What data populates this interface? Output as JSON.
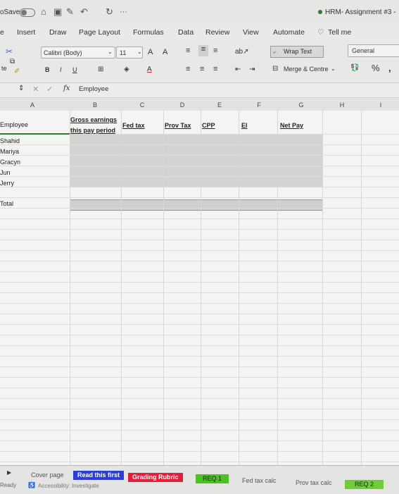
{
  "titlebar": {
    "autosave": "oSave",
    "more": "···",
    "doc_title": "HRM- Assignment #3 -",
    "icons": [
      "home-icon",
      "save-icon",
      "edit-icon",
      "undo-icon",
      "redo-icon"
    ]
  },
  "menu": {
    "items": [
      "e",
      "Insert",
      "Draw",
      "Page Layout",
      "Formulas",
      "Data",
      "Review",
      "View",
      "Automate"
    ],
    "tell_me": "Tell me"
  },
  "ribbon": {
    "paste": "te",
    "font_name": "Calibri (Body)",
    "font_size": "11",
    "bold": "B",
    "italic": "I",
    "underline": "U",
    "grow_font": "A",
    "shrink_font": "A",
    "font_color": "A",
    "wrap_text": "Wrap Text",
    "merge_center": "Merge & Centre",
    "number_format": "General",
    "percent": "%",
    "comma": "̓"
  },
  "formula_bar": {
    "fx": "fx",
    "value": "Employee"
  },
  "columns": [
    "A",
    "B",
    "C",
    "D",
    "E",
    "F",
    "G",
    "H",
    "I"
  ],
  "sheet": {
    "header_employee": "Employee",
    "header_gross_1": "Gross earnings",
    "header_gross_2": "this pay period",
    "header_fed": "Fed tax",
    "header_prov": "Prov Tax",
    "header_cpp": "CPP",
    "header_ei": "EI",
    "header_net": "Net Pay",
    "employees": [
      "Shahid",
      "Mariya",
      "Gracyn",
      "Jun",
      "Jerry"
    ],
    "total_label": "Total"
  },
  "tabs": {
    "cover": "Cover page",
    "read_first": "Read this first",
    "grading": "Grading Rubric",
    "req1": "REQ 1",
    "fed_calc": "Fed tax calc",
    "prov_calc": "Prov tax calc",
    "req2": "REQ 2",
    "colors": {
      "read_first": "#2b3fd6",
      "grading": "#e01f3d",
      "req1": "#4fbf26",
      "req2": "#6ecb3c"
    }
  },
  "status": {
    "ready": "Ready",
    "accessibility": "Accessibility: Investigate"
  }
}
